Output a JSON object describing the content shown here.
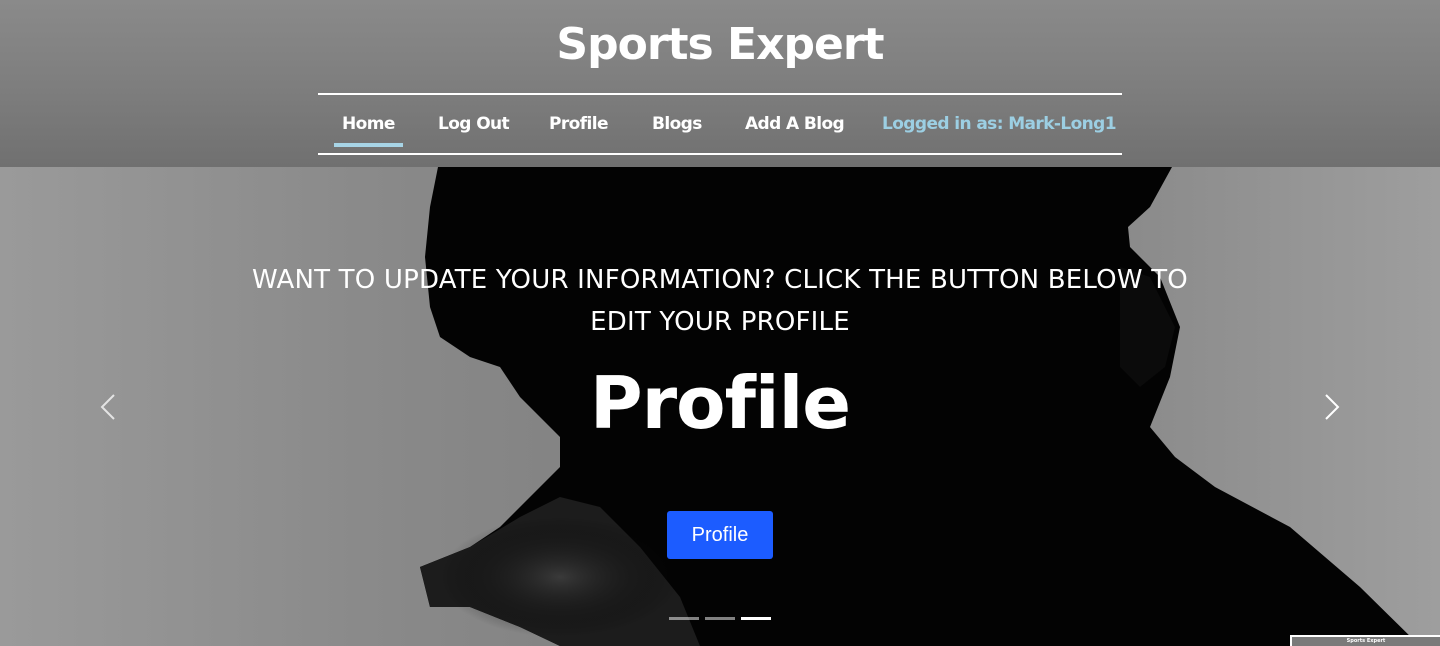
{
  "header": {
    "brand": "Sports Expert",
    "nav": [
      {
        "label": "Home",
        "active": true
      },
      {
        "label": "Log Out",
        "active": false
      },
      {
        "label": "Profile",
        "active": false
      },
      {
        "label": "Blogs",
        "active": false
      },
      {
        "label": "Add A Blog",
        "active": false
      }
    ],
    "logged_in_text": "Logged in as: Mark-Long1"
  },
  "hero": {
    "caption_line1": "WANT TO UPDATE YOUR INFORMATION? CLICK THE BUTTON BELOW TO",
    "caption_line2": "EDIT YOUR PROFILE",
    "title": "Profile",
    "button_label": "Profile",
    "prev_icon": "chevron-left-icon",
    "next_icon": "chevron-right-icon",
    "slide_count": 3,
    "active_slide": 3
  },
  "mini_thumbnail_text": "Sports Expert",
  "colors": {
    "accent_underline": "#a7d4e6",
    "logged_in_text": "#9ccfe3",
    "button": "#1c5cff",
    "header_bg": "#7d7d7d"
  }
}
